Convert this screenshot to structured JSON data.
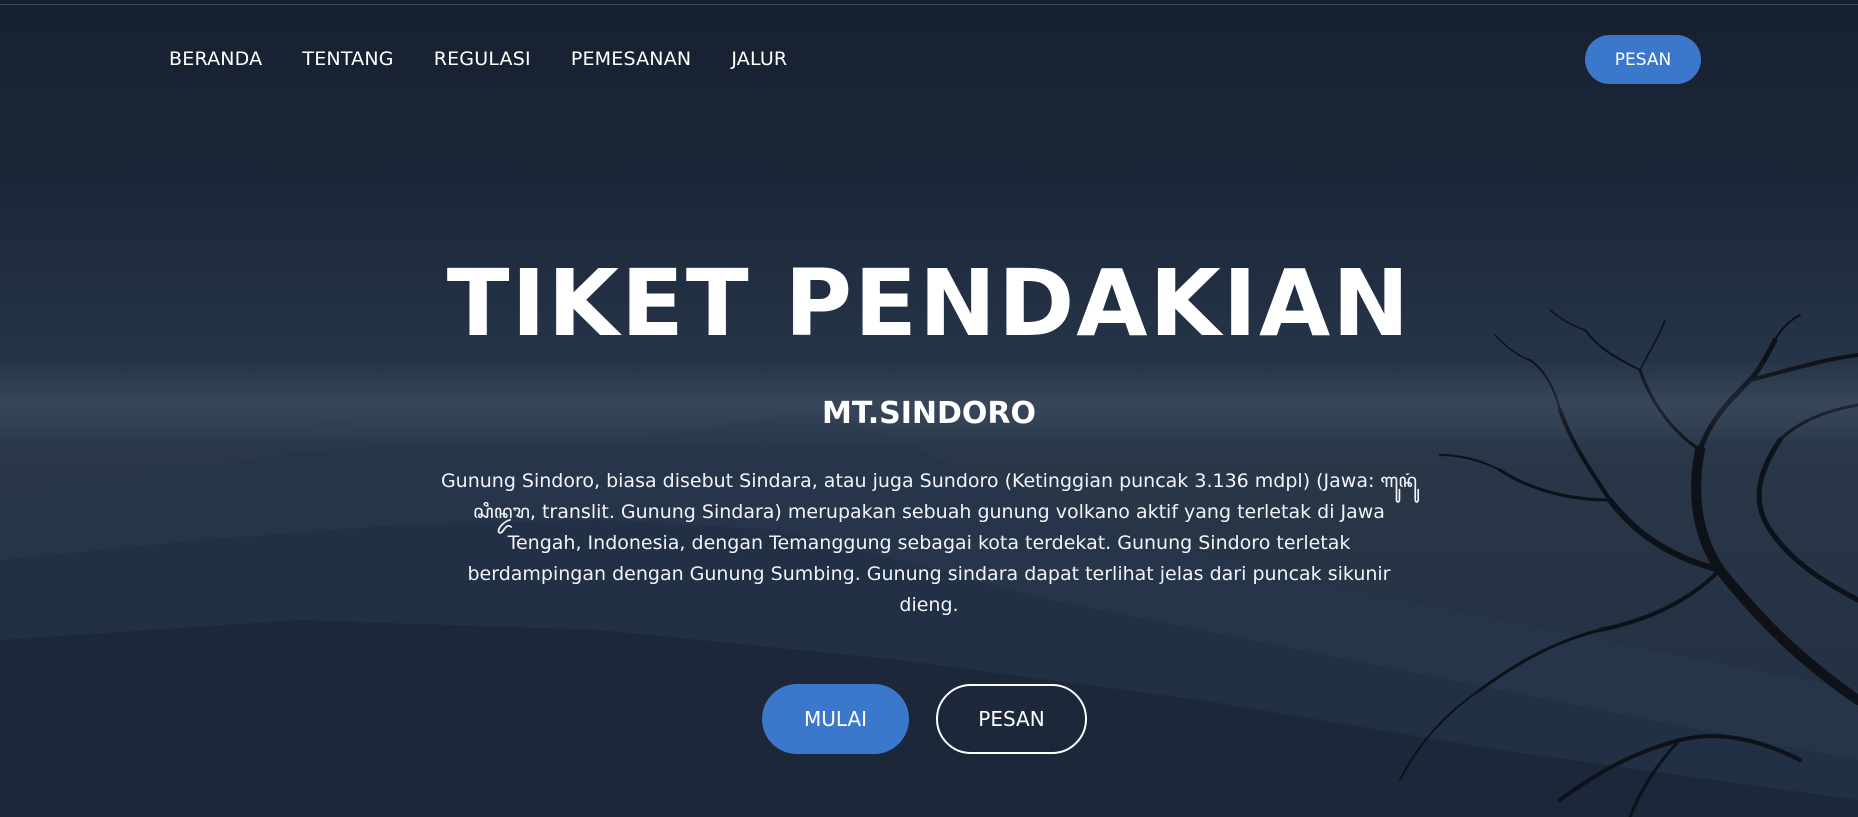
{
  "nav": {
    "items": [
      {
        "label": "BERANDA"
      },
      {
        "label": "TENTANG"
      },
      {
        "label": "REGULASI"
      },
      {
        "label": "PEMESANAN"
      },
      {
        "label": "JALUR"
      }
    ],
    "cta_label": "PESAN"
  },
  "hero": {
    "title": "TIKET PENDAKIAN",
    "subtitle": "MT.SINDORO",
    "description": "Gunung Sindoro, biasa disebut Sindara, atau juga Sundoro (Ketinggian puncak 3.136 mdpl) (Jawa: ꦒꦸꦤꦸꦁꦱꦶꦤ꧀ꦢꦫ, translit. Gunung Sindara) merupakan sebuah gunung volkano aktif yang terletak di Jawa Tengah, Indonesia, dengan Temanggung sebagai kota terdekat. Gunung Sindoro terletak berdampingan dengan Gunung Sumbing. Gunung sindara dapat terlihat jelas dari puncak sikunir dieng.",
    "primary_label": "MULAI",
    "secondary_label": "PESAN"
  },
  "colors": {
    "accent": "#3b78cc",
    "background": "#1b2738"
  }
}
